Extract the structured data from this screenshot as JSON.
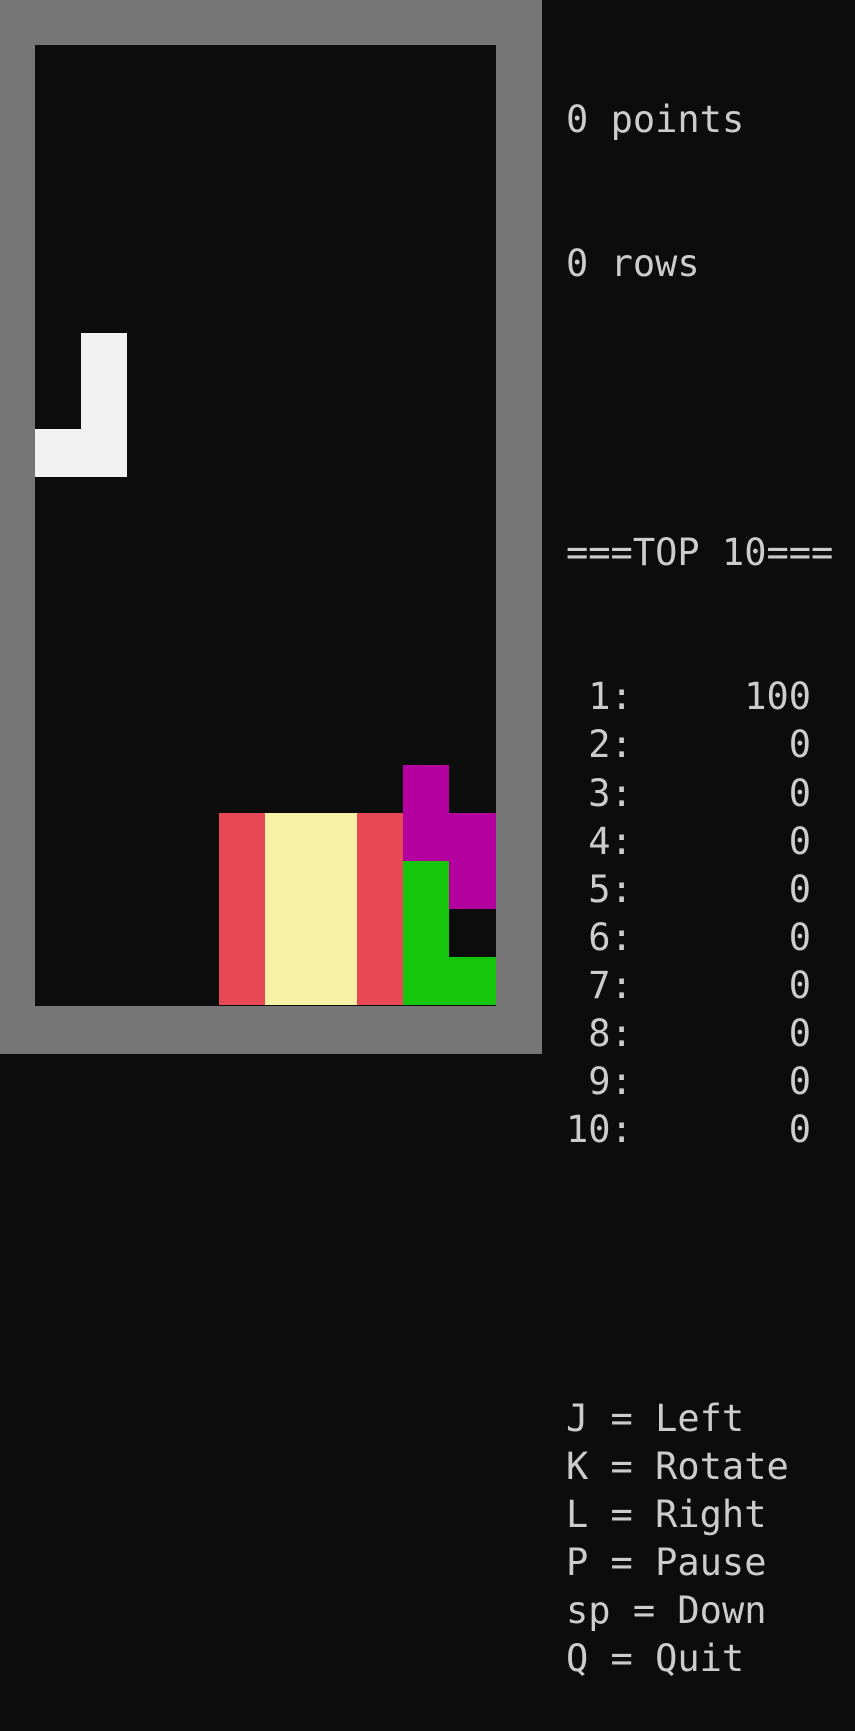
{
  "score": {
    "points_value": "0",
    "points_label": "points",
    "rows_value": "0",
    "rows_label": "rows"
  },
  "top10": {
    "header": "===TOP 10===",
    "entries": [
      {
        "rank": " 1:",
        "score": "100"
      },
      {
        "rank": " 2:",
        "score": "0"
      },
      {
        "rank": " 3:",
        "score": "0"
      },
      {
        "rank": " 4:",
        "score": "0"
      },
      {
        "rank": " 5:",
        "score": "0"
      },
      {
        "rank": " 6:",
        "score": "0"
      },
      {
        "rank": " 7:",
        "score": "0"
      },
      {
        "rank": " 8:",
        "score": "0"
      },
      {
        "rank": " 9:",
        "score": "0"
      },
      {
        "rank": "10:",
        "score": "0"
      }
    ]
  },
  "controls": [
    {
      "key": "J",
      "action": "Left"
    },
    {
      "key": "K",
      "action": "Rotate"
    },
    {
      "key": "L",
      "action": "Right"
    },
    {
      "key": "P",
      "action": "Pause"
    },
    {
      "key": "sp",
      "action": "Down"
    },
    {
      "key": "Q",
      "action": "Quit"
    }
  ],
  "board": {
    "columns": 10,
    "rows": 20,
    "colors": {
      "white": "#f2f2f2",
      "red": "#e74856",
      "yellow": "#f9f1a5",
      "magenta": "#b4009e",
      "green": "#16c60c"
    },
    "falling_piece": {
      "name": "J",
      "cells": [
        [
          1,
          6
        ],
        [
          1,
          7
        ],
        [
          0,
          8
        ],
        [
          1,
          8
        ]
      ],
      "color": "white"
    },
    "locked_cells": [
      {
        "col": 4,
        "row": 16,
        "color": "red"
      },
      {
        "col": 4,
        "row": 17,
        "color": "red"
      },
      {
        "col": 4,
        "row": 18,
        "color": "red"
      },
      {
        "col": 4,
        "row": 19,
        "color": "red"
      },
      {
        "col": 5,
        "row": 16,
        "color": "yellow"
      },
      {
        "col": 5,
        "row": 17,
        "color": "yellow"
      },
      {
        "col": 5,
        "row": 18,
        "color": "yellow"
      },
      {
        "col": 5,
        "row": 19,
        "color": "yellow"
      },
      {
        "col": 6,
        "row": 16,
        "color": "yellow"
      },
      {
        "col": 6,
        "row": 17,
        "color": "yellow"
      },
      {
        "col": 6,
        "row": 18,
        "color": "yellow"
      },
      {
        "col": 6,
        "row": 19,
        "color": "yellow"
      },
      {
        "col": 7,
        "row": 16,
        "color": "red"
      },
      {
        "col": 7,
        "row": 17,
        "color": "red"
      },
      {
        "col": 7,
        "row": 18,
        "color": "red"
      },
      {
        "col": 7,
        "row": 19,
        "color": "red"
      },
      {
        "col": 8,
        "row": 15,
        "color": "magenta"
      },
      {
        "col": 8,
        "row": 16,
        "color": "magenta"
      },
      {
        "col": 9,
        "row": 16,
        "color": "magenta"
      },
      {
        "col": 9,
        "row": 17,
        "color": "magenta"
      },
      {
        "col": 8,
        "row": 17,
        "color": "green"
      },
      {
        "col": 8,
        "row": 18,
        "color": "green"
      },
      {
        "col": 8,
        "row": 19,
        "color": "green"
      },
      {
        "col": 9,
        "row": 19,
        "color": "green"
      }
    ]
  }
}
